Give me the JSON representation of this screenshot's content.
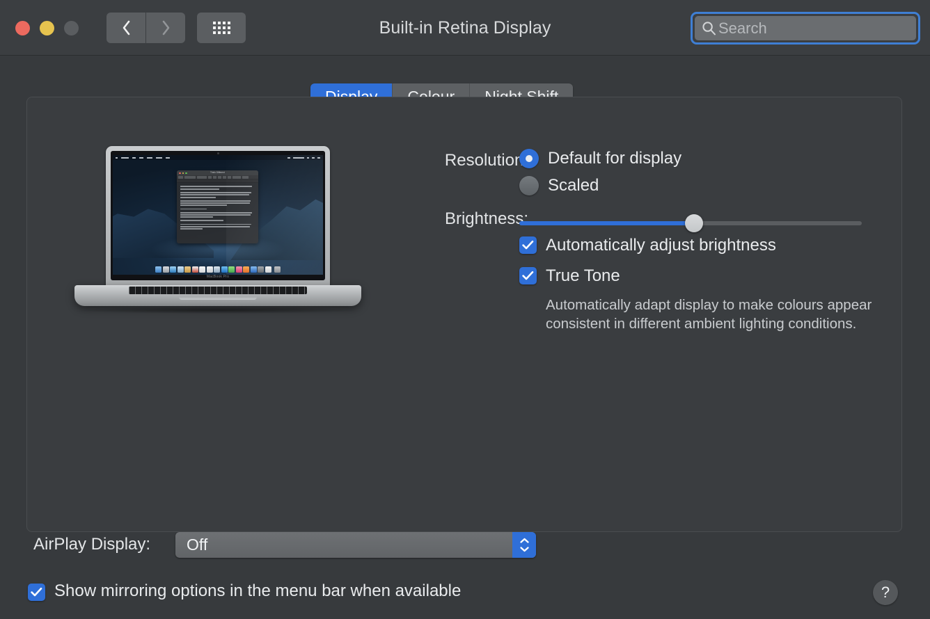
{
  "window": {
    "title": "Built-in Retina Display",
    "traffic_lights": {
      "close": "close",
      "minimize": "minimize",
      "zoom": "zoom"
    },
    "nav": {
      "back": "back",
      "forward": "forward",
      "show_all": "show-all-grid"
    }
  },
  "search": {
    "placeholder": "Search",
    "value": "",
    "icon": "search-icon",
    "focused": true,
    "focus_ring_color": "#3f7fd4"
  },
  "tabs": [
    {
      "label": "Display",
      "active": true
    },
    {
      "label": "Colour",
      "active": false
    },
    {
      "label": "Night Shift",
      "active": false
    }
  ],
  "preview": {
    "device_name": "MacBook Pro",
    "desktop_app_window_title": "Think Different",
    "menubar_status": "Wed 9:41 AM"
  },
  "display_settings": {
    "resolution": {
      "label": "Resolution:",
      "options": [
        {
          "label": "Default for display",
          "selected": true
        },
        {
          "label": "Scaled",
          "selected": false
        }
      ]
    },
    "brightness": {
      "label": "Brightness:",
      "value_percent": 51
    },
    "checkboxes": [
      {
        "label": "Automatically adjust brightness",
        "checked": true
      },
      {
        "label": "True Tone",
        "checked": true
      }
    ],
    "true_tone_description": "Automatically adapt display to make colours appear consistent in different ambient lighting conditions."
  },
  "airplay": {
    "label": "AirPlay Display:",
    "value": "Off"
  },
  "mirroring": {
    "label": "Show mirroring options in the menu bar when available",
    "checked": true
  },
  "help": {
    "glyph": "?"
  },
  "colors": {
    "accent": "#2f6fd8",
    "window_background": "#373a3d",
    "panel_background": "#3a3d40",
    "titlebar_background": "#3b3e41",
    "text_primary": "#e9ebed",
    "text_secondary": "#c9cccf"
  }
}
